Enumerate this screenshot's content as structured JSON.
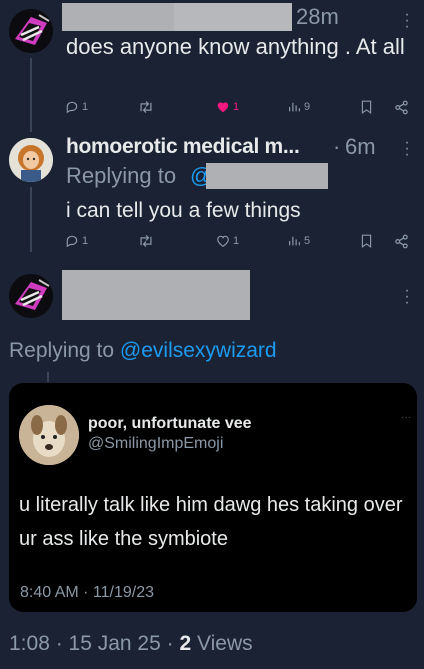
{
  "tweet1": {
    "time": "28m",
    "text": "does anyone know anything . At all",
    "reply_count": "1",
    "retweet_count": "",
    "like_count": "1",
    "views_count": "9",
    "like_color": "#f91880"
  },
  "tweet2": {
    "display_name": "homoerotic medical m...",
    "separator": "·",
    "time": "6m",
    "replying_to_label": "Replying to",
    "replying_to_handle": "@",
    "text": "i can tell you a few things",
    "reply_count": "1",
    "retweet_count": "",
    "like_count": "1",
    "views_count": "5"
  },
  "main_tweet": {
    "replying_to_label": "Replying to",
    "replying_to_handle": "@evilsexywizard",
    "timestamp_prefix": "1:08 · 15 Jan 25 · ",
    "views_number": "2",
    "views_label": "Views"
  },
  "quoted_tweet": {
    "display_name": "poor, unfortunate vee",
    "handle": "@SmilingImpEmoji",
    "text": "u literally talk like him dawg hes taking over ur ass like the symbiote",
    "timestamp": "8:40 AM · 11/19/23"
  },
  "icons": [
    "reply-icon",
    "retweet-icon",
    "like-icon",
    "views-icon",
    "bookmark-icon",
    "share-icon",
    "more-icon"
  ],
  "colors": {
    "background": "#1a2233",
    "accent": "#1d9bf0",
    "muted": "#8b98a5",
    "like": "#f91880",
    "redaction": "#aeb0b4"
  }
}
